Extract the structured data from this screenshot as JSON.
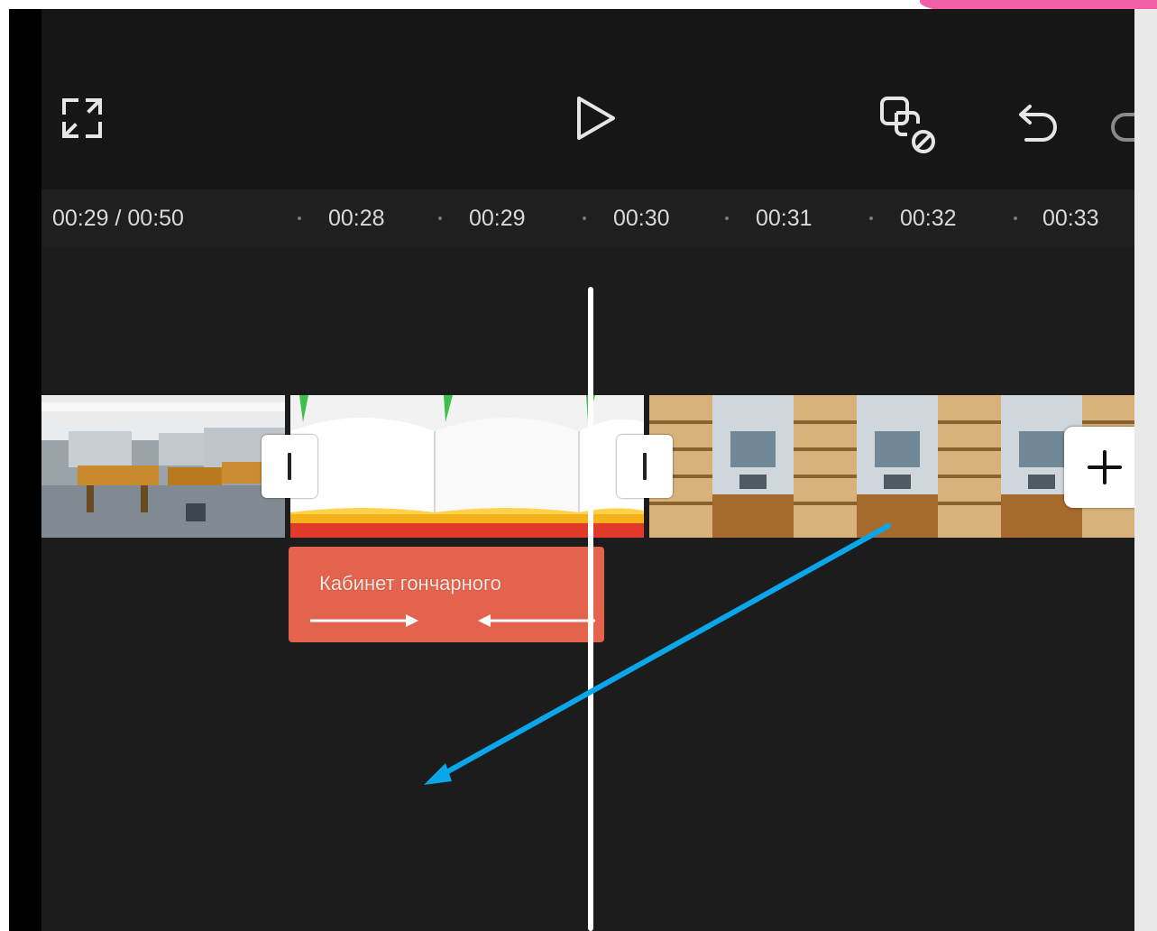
{
  "toolbar": {
    "fullscreen_icon": "expand-icon",
    "play_icon": "play-icon",
    "mute_icon": "audio-off-icon",
    "undo_icon": "undo-icon",
    "redo_icon": "redo-icon"
  },
  "timeline": {
    "time_display": "00:29 / 00:50",
    "ticks": [
      "00:28",
      "00:29",
      "00:30",
      "00:31",
      "00:32",
      "00:33"
    ]
  },
  "clips": {
    "text_overlay_label": "Кабинет гончарного",
    "add_icon": "plus-icon"
  },
  "colors": {
    "background": "#1c1c1c",
    "text_clip": "#e4634c",
    "annotation_arrow": "#0aa6ea",
    "accent_pink": "#f25fa6"
  }
}
